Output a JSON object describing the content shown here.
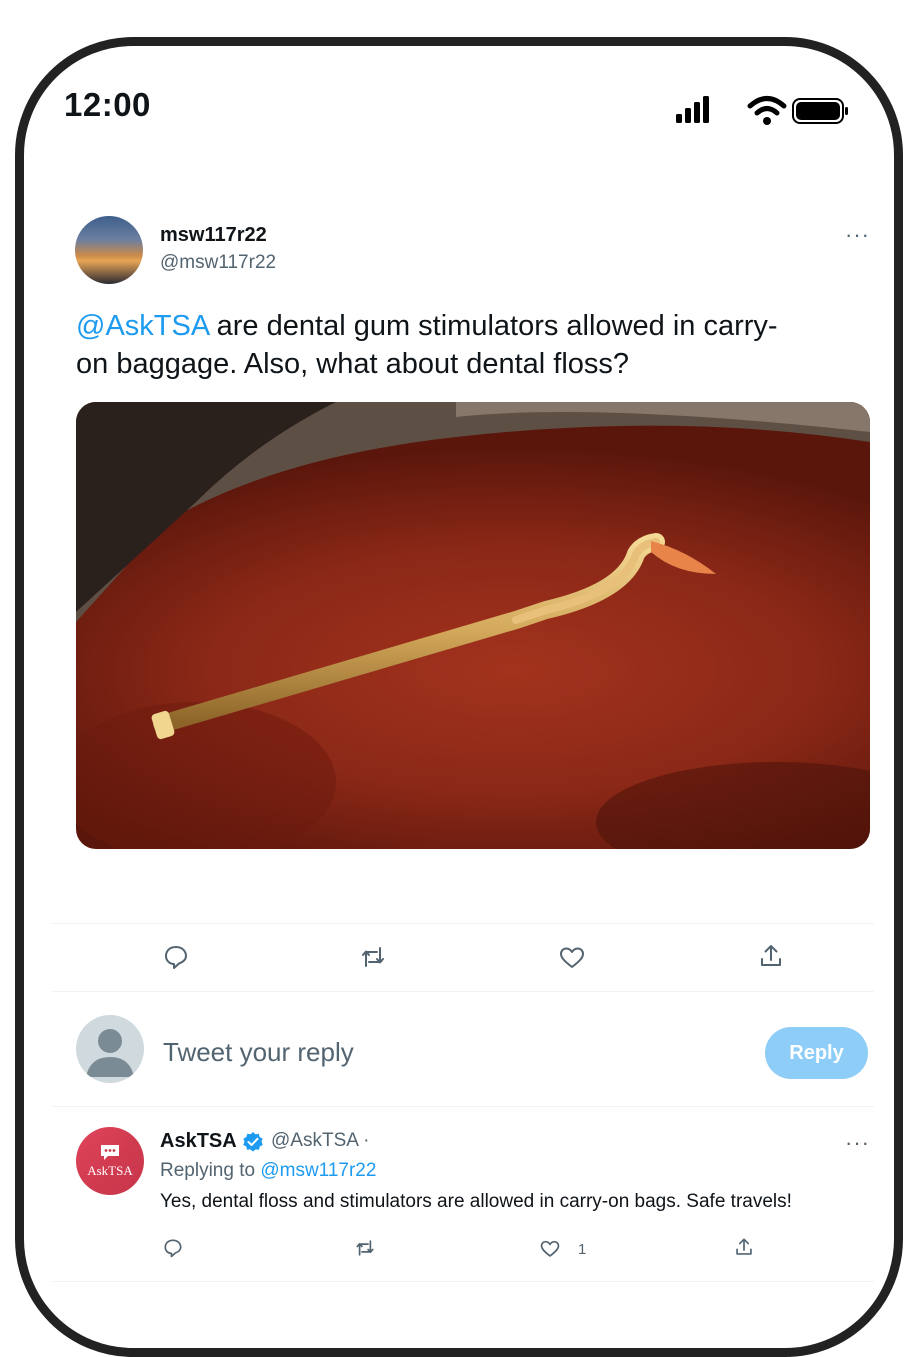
{
  "status_bar": {
    "time": "12:00",
    "icons": [
      "signal-icon",
      "wifi-icon",
      "battery-icon"
    ]
  },
  "tweet": {
    "display_name": "msw117r22",
    "handle": "@msw117r22",
    "more": "···",
    "mention": "@AskTSA",
    "text_line1_rest": " are dental gum stimulators allowed in carry-",
    "text_line2": "on baggage. Also, what about dental floss?",
    "actions": [
      "reply-icon",
      "retweet-icon",
      "like-icon",
      "share-icon"
    ]
  },
  "composer": {
    "placeholder": "Tweet your reply",
    "button_label": "Reply"
  },
  "reply": {
    "avatar_label": "AskTSA",
    "display_name": "AskTSA",
    "handle": "@AskTSA ·",
    "replying_prefix": "Replying to ",
    "replying_to": "@msw117r22",
    "text": "Yes, dental floss and stimulators are allowed in carry-on bags. Safe travels!",
    "like_count": "1",
    "more": "···"
  },
  "colors": {
    "accent": "#1d9bf0",
    "reply_button": "#8ecdf7",
    "muted": "#536471"
  }
}
